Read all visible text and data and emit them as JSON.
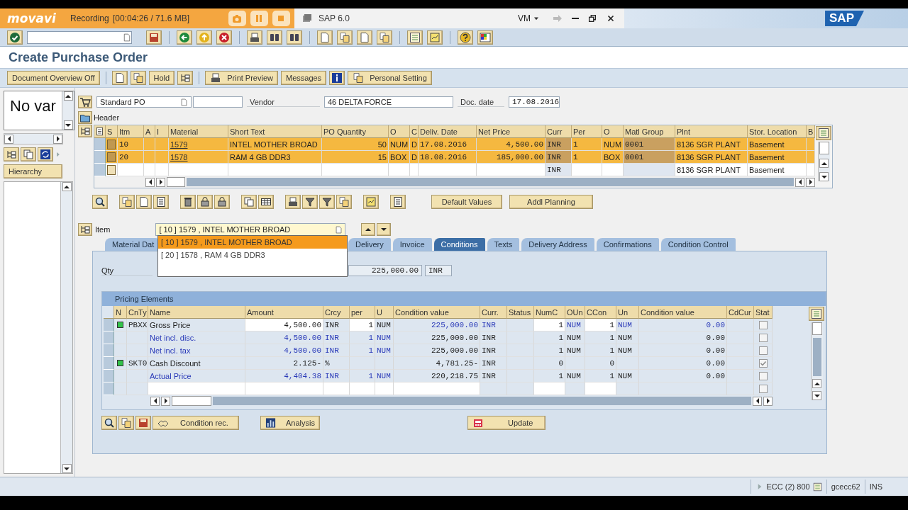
{
  "recorder": {
    "logo": "movavi",
    "status": "Recording",
    "time": "[00:04:26 / 71.6 MB]"
  },
  "window": {
    "title": "SAP 6.0",
    "menu": "VM",
    "logo": "SAP"
  },
  "page_title": "Create Purchase Order",
  "app_toolbar": [
    "Document Overview Off",
    "Hold",
    "Print Preview",
    "Messages",
    "Personal Setting"
  ],
  "left_panel": {
    "text": "No var",
    "button": "Hierarchy"
  },
  "header_fields": {
    "doc_type": "Standard PO",
    "vendor_label": "Vendor",
    "vendor": "46 DELTA FORCE",
    "date_label": "Doc. date",
    "date": "17.08.2016",
    "section": "Header"
  },
  "items": {
    "columns": [
      "S",
      "Itm",
      "A",
      "I",
      "Material",
      "Short Text",
      "PO Quantity",
      "O",
      "C",
      "Deliv. Date",
      "Net Price",
      "Curr",
      "Per",
      "O",
      "Matl Group",
      "Plnt",
      "Stor. Location",
      "B"
    ],
    "rows": [
      {
        "selected": true,
        "cells": [
          null,
          "10",
          null,
          null,
          "1579",
          "INTEL MOTHER BROAD",
          "50",
          "NUM",
          "D",
          "17.08.2016",
          "4,500.00",
          "INR",
          "1",
          "NUM",
          "0001",
          "8136 SGR PLANT",
          "Basement",
          null
        ]
      },
      {
        "selected": true,
        "cells": [
          null,
          "20",
          null,
          null,
          "1578",
          "RAM 4 GB DDR3",
          "15",
          "BOX",
          "D",
          "18.08.2016",
          "185,000.00",
          "INR",
          "1",
          "BOX",
          "0001",
          "8136 SGR PLANT",
          "Basement",
          null
        ]
      },
      {
        "selected": false,
        "cells": [
          null,
          null,
          null,
          null,
          null,
          null,
          null,
          null,
          null,
          null,
          null,
          "INR",
          null,
          null,
          null,
          "8136 SGR PLANT",
          "Basement",
          null
        ]
      }
    ]
  },
  "item_toolbar": [
    "Default Values",
    "Addl Planning"
  ],
  "item_selector": {
    "label": "Item",
    "value": "[ 10 ] 1579 , INTEL MOTHER BROAD",
    "expanded": true,
    "options": [
      {
        "label": "[ 10 ] 1579 , INTEL MOTHER BROAD",
        "selected": true
      },
      {
        "label": "[ 20 ] 1578 , RAM 4 GB DDR3",
        "selected": false
      }
    ]
  },
  "tabs": [
    {
      "label": "Material Dat",
      "selected": false
    },
    {
      "label": "Delivery",
      "selected": false
    },
    {
      "label": "Invoice",
      "selected": false
    },
    {
      "label": "Conditions",
      "selected": true
    },
    {
      "label": "Texts",
      "selected": false
    },
    {
      "label": "Delivery Address",
      "selected": false
    },
    {
      "label": "Confirmations",
      "selected": false
    },
    {
      "label": "Condition Control",
      "selected": false
    }
  ],
  "quantity": {
    "label": "Qty",
    "value": "225,000.00",
    "unit": "INR"
  },
  "conditions": {
    "title": "Pricing Elements",
    "columns": [
      "N",
      "CnTy",
      "Name",
      "Amount",
      "Crcy",
      "per",
      "U",
      "Condition value",
      "Curr.",
      "Status",
      "NumC",
      "OUn",
      "CCon",
      "Un",
      "Condition value",
      "CdCur",
      "Stat"
    ],
    "rows": [
      {
        "kind": "condition",
        "editable": true,
        "color": "#33c24a",
        "checked": false,
        "cells": [
          null,
          "PBXX",
          "Gross Price",
          "4,500.00",
          "INR",
          "1",
          "NUM",
          "225,000.00",
          "INR",
          null,
          "1",
          "NUM",
          "1",
          "NUM",
          "0.00",
          null,
          null
        ]
      },
      {
        "kind": "subtotal",
        "editable": false,
        "checked": false,
        "cells": [
          null,
          null,
          "Net incl. disc.",
          "4,500.00",
          "INR",
          "1",
          "NUM",
          "225,000.00",
          "INR",
          null,
          "1",
          "NUM",
          "1",
          "NUM",
          "0.00",
          null,
          null
        ]
      },
      {
        "kind": "subtotal",
        "editable": false,
        "checked": false,
        "cells": [
          null,
          null,
          "Net incl. tax",
          "4,500.00",
          "INR",
          "1",
          "NUM",
          "225,000.00",
          "INR",
          null,
          "1",
          "NUM",
          "1",
          "NUM",
          "0.00",
          null,
          null
        ]
      },
      {
        "kind": "condition",
        "editable": false,
        "color": "#33c24a",
        "checked": true,
        "cells": [
          null,
          "SKT0",
          "Cash Discount",
          "2.125-",
          "%",
          null,
          null,
          "4,781.25-",
          "INR",
          null,
          "0",
          null,
          "0",
          null,
          "0.00",
          null,
          null
        ]
      },
      {
        "kind": "subtotal",
        "editable": false,
        "checked": false,
        "cells": [
          null,
          null,
          "Actual Price",
          "4,404.38",
          "INR",
          "1",
          "NUM",
          "220,218.75",
          "INR",
          null,
          "1",
          "NUM",
          "1",
          "NUM",
          "0.00",
          null,
          null
        ]
      },
      {
        "kind": "blank",
        "editable": true,
        "checked": false,
        "cells": [
          null,
          null,
          null,
          null,
          null,
          null,
          null,
          null,
          null,
          null,
          null,
          null,
          null,
          null,
          null,
          null,
          null
        ]
      }
    ]
  },
  "condition_buttons": [
    "Condition rec.",
    "Analysis",
    "Update"
  ],
  "status_bar": {
    "system": "ECC (2) 800",
    "server": "gcecc62",
    "mode": "INS"
  }
}
